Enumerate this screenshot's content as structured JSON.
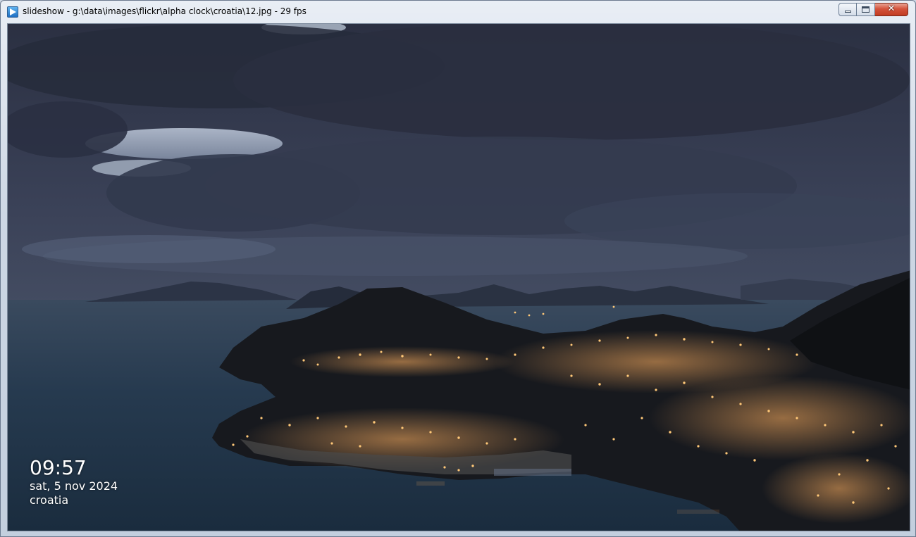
{
  "window": {
    "title": "slideshow - g:\\data\\images\\flickr\\alpha clock\\croatia\\12.jpg - 29 fps",
    "close_label": "✕"
  },
  "overlay": {
    "time": "09:57",
    "date": "sat, 5 nov 2024",
    "location": "croatia"
  },
  "icons": {
    "app": "slideshow-play-icon",
    "minimize": "minimize-icon",
    "maximize": "maximize-icon",
    "close": "close-icon"
  },
  "colors": {
    "sky": "#3b4358",
    "sea": "#1f3346",
    "land": "#15191e",
    "city_lights": "#ffb060"
  }
}
